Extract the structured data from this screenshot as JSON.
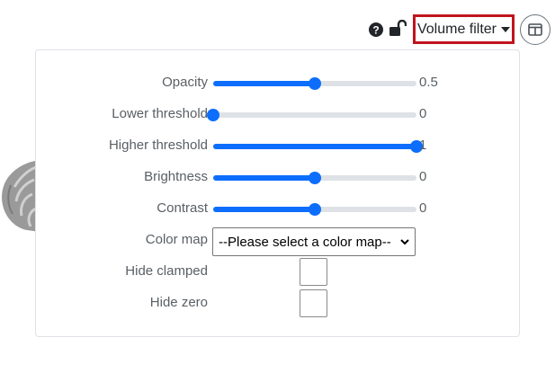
{
  "toolbar": {
    "help_icon": "question-circle-icon",
    "lock_icon": "unlocked-lock-icon",
    "volume_filter_label": "Volume filter",
    "layout_icon": "split-columns-icon"
  },
  "panel": {
    "sliders": [
      {
        "label": "Opacity",
        "value": "0.5",
        "fraction": 0.5
      },
      {
        "label": "Lower threshold",
        "value": "0",
        "fraction": 0.0
      },
      {
        "label": "Higher threshold",
        "value": "1",
        "fraction": 1.0
      },
      {
        "label": "Brightness",
        "value": "0",
        "fraction": 0.5
      },
      {
        "label": "Contrast",
        "value": "0",
        "fraction": 0.5
      }
    ],
    "color_map": {
      "label": "Color map",
      "selected": "--Please select a color map--"
    },
    "hide_clamped": {
      "label": "Hide clamped",
      "checked": false
    },
    "hide_zero": {
      "label": "Hide zero",
      "checked": false
    }
  },
  "colors": {
    "accent": "#0d6efd",
    "highlight_border": "#c0141e"
  }
}
